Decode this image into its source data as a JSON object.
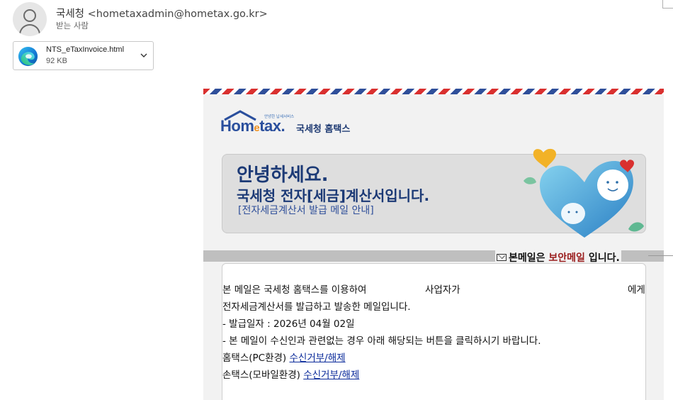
{
  "header": {
    "sender_name": "국세청",
    "sender_email": "<hometaxadmin@hometax.go.kr>",
    "recipient_label": "받는 사람"
  },
  "attachment": {
    "file_name": "NTS_eTaxInvoice.html",
    "file_size": "92 KB",
    "icon": "edge-browser-icon"
  },
  "logo": {
    "slogan": "안녕한 납세서비스",
    "word": "Hometax.",
    "korean": "국세청 홈택스"
  },
  "banner": {
    "greeting": "안녕하세요.",
    "title": "국세청 전자[세금]계산서입니다.",
    "subtitle": "[전자세금계산서 발급 메일 안내]"
  },
  "secure_notice": {
    "prefix": "본메일은",
    "highlight": "보안메일",
    "suffix": "입니다."
  },
  "content": {
    "line1_start": "본 메일은 국세청 홈택스를 이용하여",
    "line1_mid": "사업자가",
    "line1_end": "에게",
    "line2": "전자세금계산서를 발급하고 발송한 메일입니다.",
    "line3": "- 발급일자 : 2026년 04월 02일",
    "line4": "- 본 메일이 수신인과 관련없는 경우 아래 해당되는 버튼을 클릭하시기 바랍니다.",
    "line5_label": "홈택스(PC환경)",
    "line5_link": "수신거부/해제",
    "line6_label": "손택스(모바일환경)",
    "line6_link": "수신거부/해제"
  },
  "colors": {
    "brand_navy": "#1c3a76",
    "link_blue": "#0a2a9a",
    "secure_red": "#9a1d1d",
    "airmail_red": "#d9302f",
    "airmail_blue": "#2f4f9a"
  }
}
